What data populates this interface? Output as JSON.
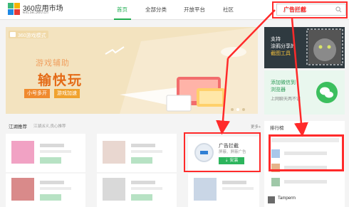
{
  "header": {
    "logo_title": "360应用市场",
    "logo_sub": "ext.se.360.cn",
    "nav": [
      "首页",
      "全部分类",
      "开放平台",
      "社区"
    ],
    "search_placeholder": "广告拦截"
  },
  "banner": {
    "badge": "360游戏模式",
    "line1": "游戏辅助",
    "line2": "输快玩",
    "pill1": "小号多开",
    "pill2": "游戏加速"
  },
  "promo1": {
    "l1": "支持",
    "l2": "涂鸦分享的",
    "l3": "截图工具"
  },
  "promo2": {
    "l1": "添加微信到",
    "l2": "浏览器",
    "l3": "上网聊天两不误"
  },
  "section": {
    "title": "江湖推荐",
    "subtitle": "江湖派义,良心推荐",
    "more": "更多+",
    "rank_title": "排行榜"
  },
  "ad_card": {
    "name": "广告拦截",
    "desc": "屏蔽、屏蔽广告",
    "install": "安装"
  },
  "rank_item": "Tamperm",
  "annotation": {
    "label": "广告拦截"
  },
  "colors": {
    "accent": "#1fae50",
    "annotation": "#ff2a2a",
    "banner_bg": "#f3e3bf"
  }
}
